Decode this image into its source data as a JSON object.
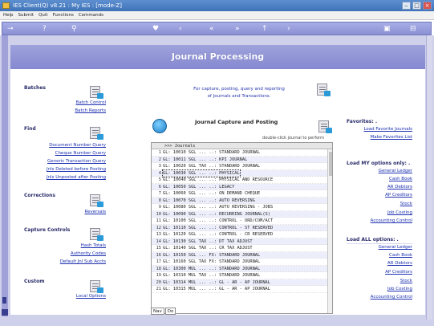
{
  "window": {
    "title": "IES Client(Q) v8.21 : My IES :       [mode-Z]"
  },
  "menu": [
    "Help",
    "Submit",
    "Quit",
    "Functions",
    "Commands"
  ],
  "toolbar": {
    "icons": [
      "power-icon",
      "info-icon",
      "search-icon",
      "heart-icon",
      "back-icon",
      "rewind-icon",
      "forward-icon",
      "fast-forward-icon",
      "up-icon",
      "expand-icon",
      "collapse-icon"
    ]
  },
  "header": {
    "title": "Journal Processing"
  },
  "left": {
    "batches": {
      "heading": "Batches",
      "links": [
        "Batch Control",
        "Batch Reports"
      ]
    },
    "find": {
      "heading": "Find",
      "links": [
        "Document Number Query",
        "Cheque Number Query",
        "Generic Transaction Query",
        "Jnls Deleted before Posting",
        "Jnls Unposted after Posting"
      ]
    },
    "corrections": {
      "heading": "Corrections",
      "links": [
        "Reversals"
      ]
    },
    "capture": {
      "heading": "Capture Controls",
      "links": [
        "Hash Totals",
        "Authority Codes",
        "Default Jnl Sub Accts"
      ]
    },
    "custom": {
      "heading": "Custom",
      "links": [
        "Local Options"
      ]
    }
  },
  "center": {
    "intro_line1": "For capture, posting, query and reporting",
    "intro_line2": "of Journals and Transactions.",
    "jcp_title": "Journal Capture and Posting",
    "hint": "double-click journal to perform",
    "list_header": ">>> Journals",
    "rows": [
      "GL: 10010 SGL ... ..: STANDARD JOURNAL",
      "GL: 10011 SGL ... ..: KPI JOURNAL",
      "GL: 10020 SGL TAX ..: STANDARD JOURNAL",
      "GL: 10030 SGL ... ..: PHYSICAL",
      "GL: 10040 SGL ... ..: PHYSICAL AND RESOURCE",
      "GL: 10050 SGL ... ..: LEGACY",
      "GL: 10060 SGL ... ..: ON DEMAND CHEQUE",
      "GL: 10070 SGL ... ..: AUTO REVERSING",
      "GL: 10080 SGL ... ..: AUTO REVERSING - JOBS",
      "GL: 10090 SGL ... ..: RECURRING JOURNAL(S)",
      "GL: 10100 SGL ... ..: CONTROL - ORD/COM/ACT",
      "GL: 10110 SGL ... ..: CONTROL - ST RESERVED",
      "GL: 10120 SGL ... ..: CONTROL - CR RESERVED",
      "GL: 10130 SGL TAX ..: DT TAX ADJUST",
      "GL: 10140 SGL TAX ..: CR TAX ADJUST",
      "GL: 10150 SGL ... FX: STANDARD JOURNAL",
      "GL: 10160 SGL TAX FX: STANDARD JOURNAL",
      "GL: 10300 MUL ... ..: STANDARD JOURNAL",
      "GL: 10310 MUL TAX ..: STANDARD JOURNAL",
      "GL: 10314 MUL ... ..: GL - AR - AP JOURNAL",
      "GL: 10315 MUL ... ..: GL - AR - AP JOURNAL"
    ],
    "tabs": [
      "Nav",
      "Do"
    ]
  },
  "right": {
    "favorites": {
      "heading": "Favorites: .",
      "links": [
        "Load Favorite Journals",
        "Make Favorites List"
      ]
    },
    "load_my": {
      "heading": "Load MY options only: .",
      "links": [
        "General Ledger",
        "Cash Book",
        "AR Debtors",
        "AP Creditors",
        "Stock",
        "Job Costing",
        "Accounting Control"
      ]
    },
    "load_all": {
      "heading": "Load ALL options: .",
      "links": [
        "General Ledger",
        "Cash Book",
        "AR Debtors",
        "AP Creditors",
        "Stock",
        "Job Costing",
        "Accounting Control"
      ]
    }
  }
}
